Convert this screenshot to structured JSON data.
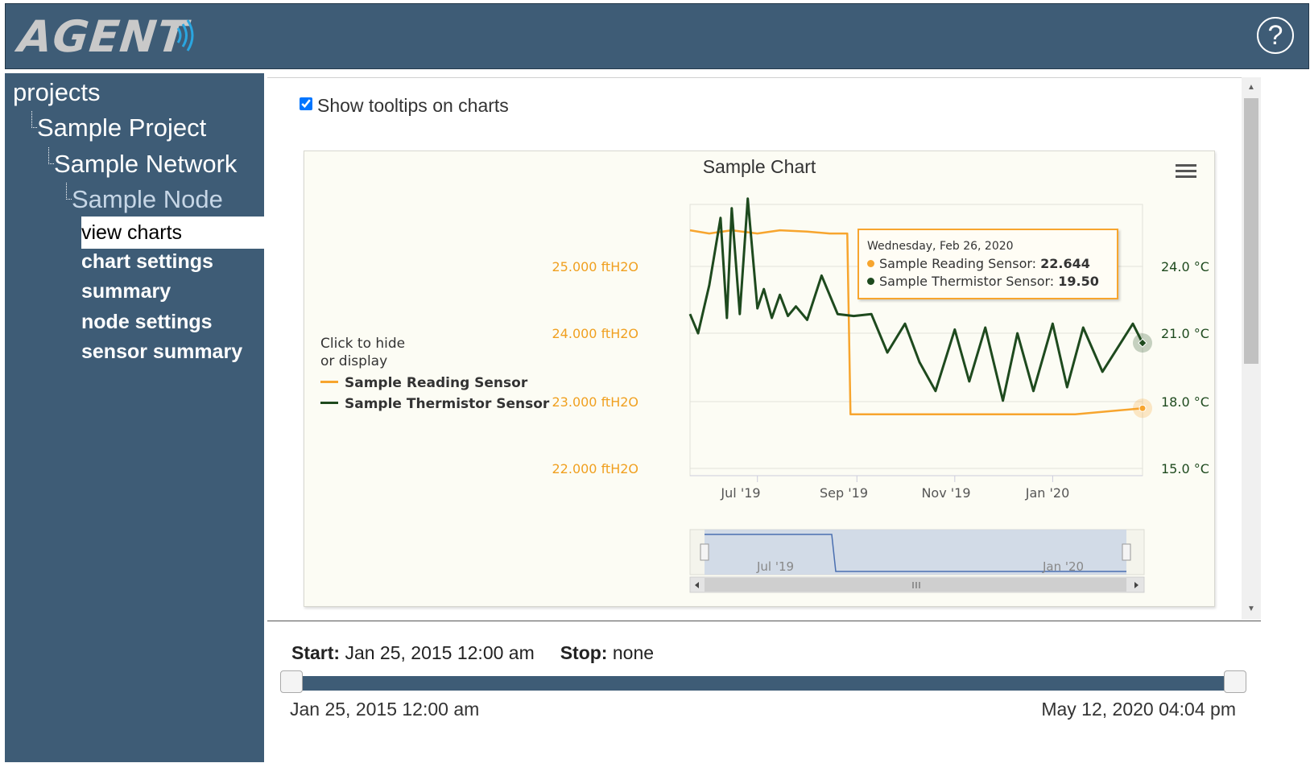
{
  "app": {
    "logo_text": "AGENT",
    "help_icon": "question-circle-icon",
    "help_glyph": "?"
  },
  "sidebar": {
    "tree": [
      "projects",
      "Sample Project",
      "Sample Network",
      "Sample Node"
    ],
    "nav_items": [
      "view charts",
      "chart settings",
      "summary",
      "node settings",
      "sensor summary"
    ],
    "active_item": "view charts"
  },
  "content": {
    "tooltip_checkbox_label": "Show tooltips on charts",
    "tooltip_checkbox_checked": true
  },
  "chart_data": {
    "type": "line",
    "title": "Sample Chart",
    "legend_hint": [
      "Click to hide",
      "or display"
    ],
    "legend_placement": "left",
    "series": [
      {
        "name": "Sample Reading Sensor",
        "color": "#f7a52e",
        "axis": "left",
        "x": [
          "2019-05-20",
          "2019-06-01",
          "2019-06-15",
          "2019-07-01",
          "2019-07-15",
          "2019-08-01",
          "2019-08-15",
          "2019-08-26",
          "2019-08-28",
          "2019-09-15",
          "2019-10-15",
          "2019-11-15",
          "2019-12-15",
          "2020-01-15",
          "2020-02-26"
        ],
        "values": [
          25.4,
          25.35,
          25.4,
          25.35,
          25.4,
          25.38,
          25.35,
          25.35,
          22.55,
          22.55,
          22.55,
          22.55,
          22.55,
          22.55,
          22.644
        ]
      },
      {
        "name": "Sample Thermistor Sensor",
        "color": "#1e4a1e",
        "axis": "right",
        "x": [
          "2019-05-20",
          "2019-05-25",
          "2019-06-01",
          "2019-06-08",
          "2019-06-12",
          "2019-06-15",
          "2019-06-20",
          "2019-06-25",
          "2019-07-01",
          "2019-07-05",
          "2019-07-10",
          "2019-07-15",
          "2019-07-20",
          "2019-07-25",
          "2019-08-01",
          "2019-08-10",
          "2019-08-20",
          "2019-08-30",
          "2019-09-10",
          "2019-09-20",
          "2019-10-01",
          "2019-10-10",
          "2019-10-20",
          "2019-11-01",
          "2019-11-10",
          "2019-11-20",
          "2019-12-01",
          "2019-12-10",
          "2019-12-20",
          "2020-01-01",
          "2020-01-10",
          "2020-01-20",
          "2020-02-01",
          "2020-02-20",
          "2020-02-26"
        ],
        "values": [
          21.0,
          20.0,
          22.5,
          26.0,
          20.8,
          26.5,
          21.0,
          27.0,
          21.3,
          22.3,
          20.8,
          22.0,
          20.9,
          21.4,
          20.7,
          23.0,
          21.0,
          20.9,
          21.0,
          19.0,
          20.5,
          18.5,
          17.0,
          20.2,
          17.5,
          20.3,
          16.5,
          20.0,
          17.0,
          20.5,
          17.2,
          20.3,
          18.0,
          20.5,
          19.5
        ]
      }
    ],
    "x_ticks": [
      "Jul '19",
      "Sep '19",
      "Nov '19",
      "Jan '20"
    ],
    "y_left_ticks": [
      "25.000 ftH2O",
      "24.000 ftH2O",
      "23.000 ftH2O",
      "22.000 ftH2O"
    ],
    "y_right_ticks": [
      "24.0 °C",
      "21.0 °C",
      "18.0 °C",
      "15.0 °C"
    ],
    "y_left_range": [
      21.6,
      25.8
    ],
    "y_right_range": [
      12.6,
      26.7
    ],
    "grid": true,
    "navigator_labels": [
      "Jul '19",
      "Jan '20"
    ],
    "tooltip": {
      "date": "Wednesday, Feb 26, 2020",
      "rows": [
        {
          "label": "Sample Reading Sensor:",
          "value": "22.644",
          "color": "#f7a52e"
        },
        {
          "label": "Sample Thermistor Sensor:",
          "value": "19.50",
          "color": "#1e4a1e"
        }
      ]
    }
  },
  "range": {
    "start_label": "Start:",
    "start_value": "Jan 25, 2015 12:00 am",
    "stop_label": "Stop:",
    "stop_value": "none",
    "slider_min": "Jan 25, 2015 12:00 am",
    "slider_max": "May 12, 2020 04:04 pm"
  }
}
